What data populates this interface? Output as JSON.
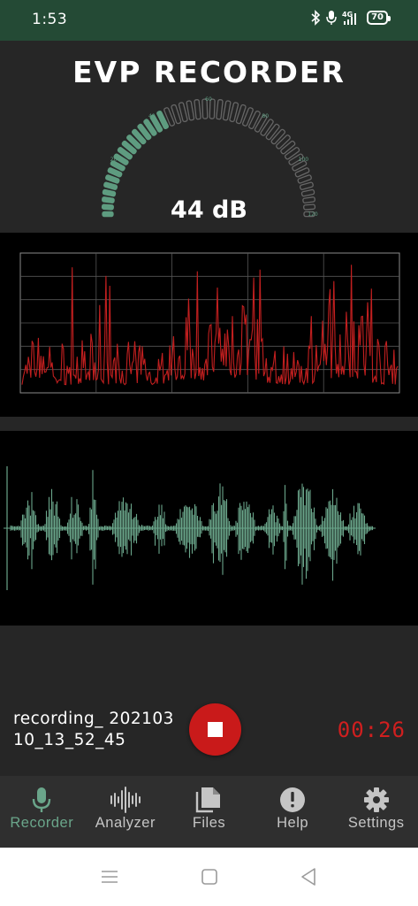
{
  "status_bar": {
    "time": "1:53",
    "battery": "70",
    "network": "4G"
  },
  "app": {
    "title": "EVP RECORDER"
  },
  "meter": {
    "level_db": 44,
    "readout": "44 dB",
    "scale_labels": [
      "0",
      "20",
      "40",
      "60",
      "80",
      "100",
      "120"
    ],
    "active_color": "#5e9c80",
    "inactive_color": "#666666"
  },
  "recording": {
    "filename": "recording_ 20210310_13_52_45",
    "elapsed": "00:26"
  },
  "controls": {
    "stop_label": "Stop"
  },
  "colors": {
    "spectrum": "#c21f1f",
    "waveform": "#6aa58a",
    "accent_red": "#c91a1a"
  },
  "nav": {
    "items": [
      {
        "label": "Recorder",
        "icon": "mic-icon",
        "active": true
      },
      {
        "label": "Analyzer",
        "icon": "waveform-icon",
        "active": false
      },
      {
        "label": "Files",
        "icon": "files-icon",
        "active": false
      },
      {
        "label": "Help",
        "icon": "help-icon",
        "active": false
      },
      {
        "label": "Settings",
        "icon": "gear-icon",
        "active": false
      }
    ]
  },
  "system_nav": {
    "items": [
      "menu-icon",
      "home-icon",
      "back-icon"
    ]
  }
}
